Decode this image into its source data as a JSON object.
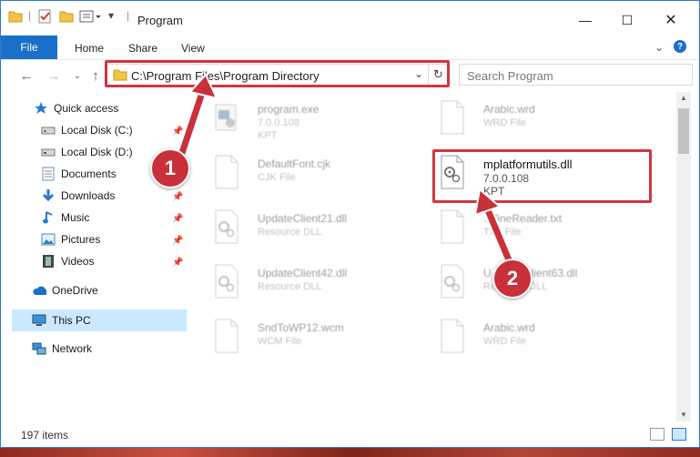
{
  "window": {
    "title": "Program"
  },
  "ribbon": {
    "file": "File",
    "home": "Home",
    "share": "Share",
    "view": "View"
  },
  "address": {
    "path": "C:\\Program Files\\Program Directory"
  },
  "search": {
    "placeholder": "Search Program"
  },
  "nav": {
    "quick_access": "Quick access",
    "items": [
      {
        "label": "Local Disk (C:)",
        "icon": "drive-icon",
        "pinned": true
      },
      {
        "label": "Local Disk (D:)",
        "icon": "drive-icon",
        "pinned": false
      },
      {
        "label": "Documents",
        "icon": "documents-icon",
        "pinned": true
      },
      {
        "label": "Downloads",
        "icon": "downloads-icon",
        "pinned": true
      },
      {
        "label": "Music",
        "icon": "music-icon",
        "pinned": true
      },
      {
        "label": "Pictures",
        "icon": "pictures-icon",
        "pinned": true
      },
      {
        "label": "Videos",
        "icon": "videos-icon",
        "pinned": true
      }
    ],
    "onedrive": "OneDrive",
    "this_pc": "This PC",
    "network": "Network"
  },
  "files": [
    {
      "name": "program.exe",
      "type": "7.0.0.108",
      "company": "KPT",
      "icon": "program-icon"
    },
    {
      "name": "Arabic.wrd",
      "type": "WRD File",
      "company": "",
      "icon": "file-icon"
    },
    {
      "name": "DefaultFont.cjk",
      "type": "CJK File",
      "company": "",
      "icon": "file-icon"
    },
    {
      "name": "mplatformutils.dll",
      "type": "7.0.0.108",
      "company": "KPT",
      "icon": "dll-gear-icon"
    },
    {
      "name": "UpdateClient21.dll",
      "type": "Resource DLL",
      "company": "",
      "icon": "dll-gear-icon"
    },
    {
      "name": "…fineReader.txt",
      "type": "TXT File",
      "company": "",
      "icon": "file-icon"
    },
    {
      "name": "UpdateClient42.dll",
      "type": "Resource DLL",
      "company": "",
      "icon": "dll-gear-icon"
    },
    {
      "name": "U…dateClient63.dll",
      "type": "Resource DLL",
      "company": "",
      "icon": "dll-gear-icon"
    },
    {
      "name": "SndToWP12.wcm",
      "type": "WCM File",
      "company": "",
      "icon": "file-icon"
    },
    {
      "name": "Arabic.wrd",
      "type": "WRD File",
      "company": "",
      "icon": "file-icon"
    }
  ],
  "status": {
    "items": "197 items"
  },
  "callouts": {
    "one": "1",
    "two": "2"
  },
  "colors": {
    "accent": "#1a6fc8",
    "highlight": "#d1363f",
    "selected": "#cce8ff"
  }
}
